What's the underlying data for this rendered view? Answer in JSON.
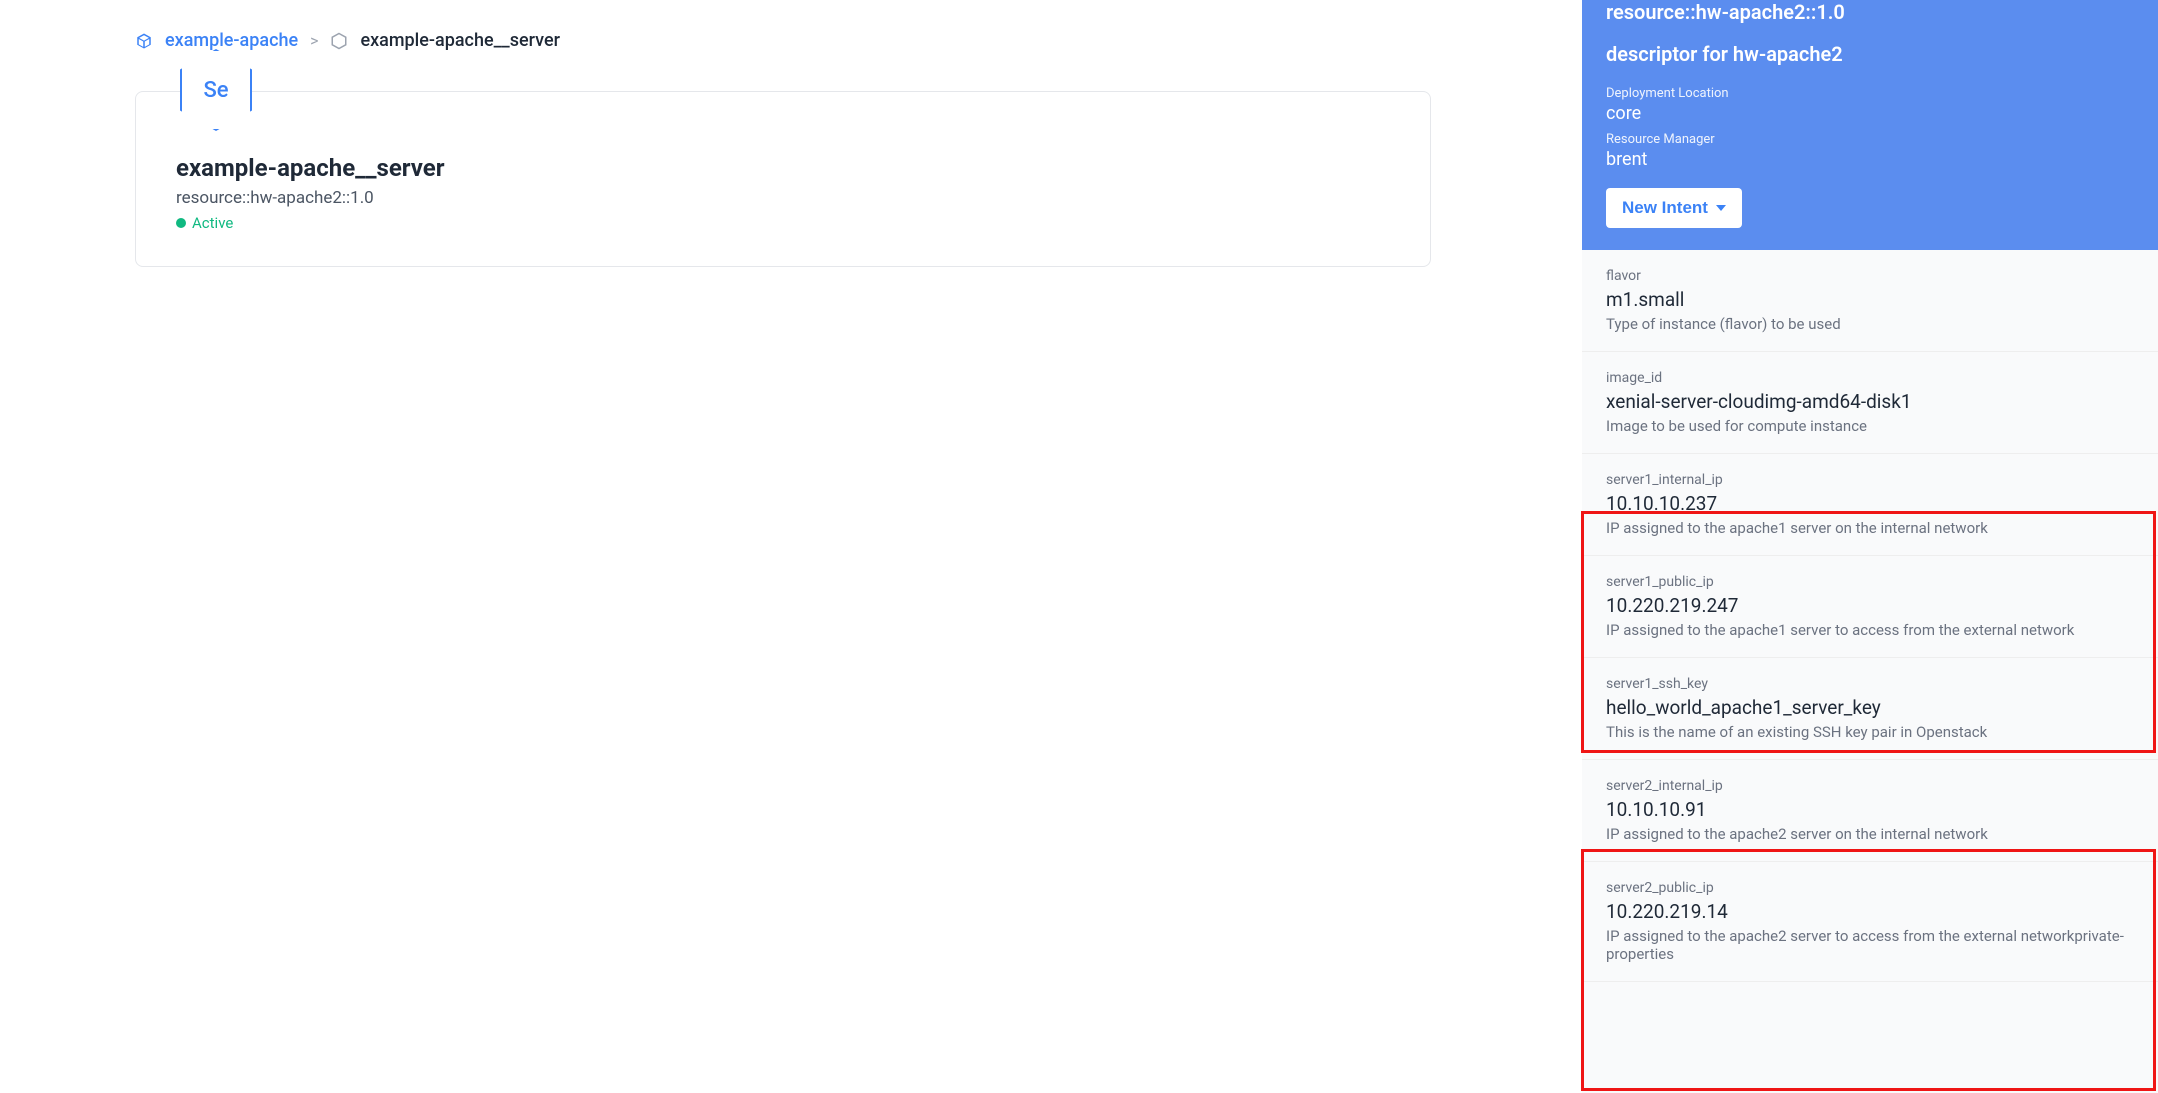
{
  "breadcrumb": {
    "parent": "example-apache",
    "current": "example-apache__server"
  },
  "card": {
    "hex_label": "Se",
    "title": "example-apache__server",
    "subtitle": "resource::hw-apache2::1.0",
    "status": "Active"
  },
  "panel": {
    "resource": "resource::hw-apache2::1.0",
    "descriptor": "descriptor for hw-apache2",
    "deployment_location_label": "Deployment Location",
    "deployment_location": "core",
    "resource_manager_label": "Resource Manager",
    "resource_manager": "brent",
    "new_intent_label": "New Intent",
    "properties": [
      {
        "key": "flavor",
        "value": "m1.small",
        "desc": "Type of instance (flavor) to be used"
      },
      {
        "key": "image_id",
        "value": "xenial-server-cloudimg-amd64-disk1",
        "desc": "Image to be used for compute instance"
      },
      {
        "key": "server1_internal_ip",
        "value": "10.10.10.237",
        "desc": "IP assigned to the apache1 server on the internal network"
      },
      {
        "key": "server1_public_ip",
        "value": "10.220.219.247",
        "desc": "IP assigned to the apache1 server to access from the external network"
      },
      {
        "key": "server1_ssh_key",
        "value": "hello_world_apache1_server_key",
        "desc": "This is the name of an existing SSH key pair in Openstack"
      },
      {
        "key": "server2_internal_ip",
        "value": "10.10.10.91",
        "desc": "IP assigned to the apache2 server on the internal network"
      },
      {
        "key": "server2_public_ip",
        "value": "10.220.219.14",
        "desc": "IP assigned to the apache2 server to access from the external networkprivate-properties"
      }
    ]
  }
}
